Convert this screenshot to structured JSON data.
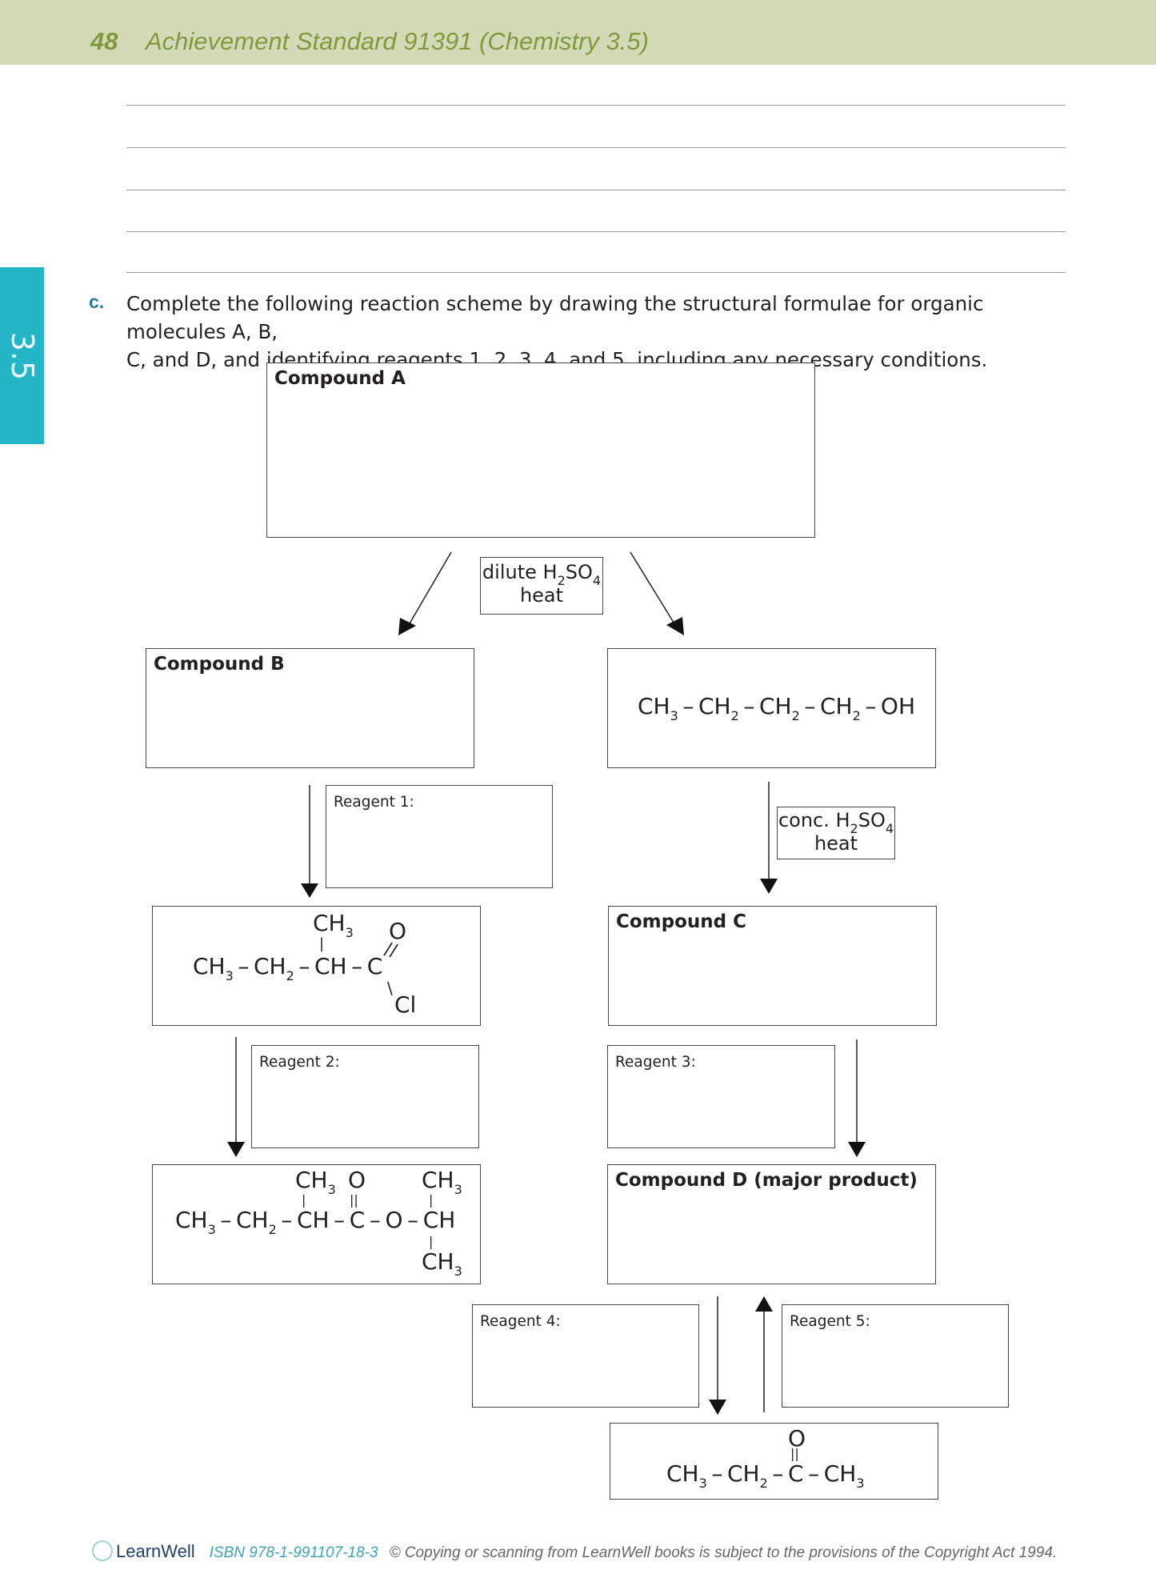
{
  "header": {
    "page_number": "48",
    "title": "Achievement Standard 91391 (Chemistry 3.5)"
  },
  "side_tab": {
    "label": "3.5"
  },
  "question": {
    "label": "c.",
    "text_line1": "Complete the following reaction scheme by drawing the structural formulae for organic molecules A, B,",
    "text_line2": "C, and D, and identifying reagents 1, 2, 3, 4, and 5, including any necessary conditions."
  },
  "scheme": {
    "compound_a": "Compound A",
    "compound_b": "Compound B",
    "compound_c": "Compound C",
    "compound_d": "Compound D (major product)",
    "reagent_1": "Reagent 1:",
    "reagent_2": "Reagent 2:",
    "reagent_3": "Reagent 3:",
    "reagent_4": "Reagent 4:",
    "reagent_5": "Reagent 5:",
    "dilute_condition": {
      "reagent": "dilute H",
      "sub1": "2",
      "mid": "SO",
      "sub2": "4",
      "line2": "heat"
    },
    "conc_condition": {
      "reagent": "conc. H",
      "sub1": "2",
      "mid": "SO",
      "sub2": "4",
      "line2": "heat"
    },
    "butanol": "CH3–CH2–CH2–CH2–OH",
    "acyl_chloride": "CH3–CH2–CH(CH3)–C(=O)Cl",
    "ester": "CH3–CH2–CH(CH3)–C(=O)–O–CH(CH3)2",
    "ketone": "CH3–CH2–C(=O)–CH3"
  },
  "footer": {
    "brand": "LearnWell",
    "isbn": "ISBN 978-1-991107-18-3",
    "copyright": "© Copying or scanning from LearnWell books is subject to the provisions of the Copyright Act 1994."
  }
}
